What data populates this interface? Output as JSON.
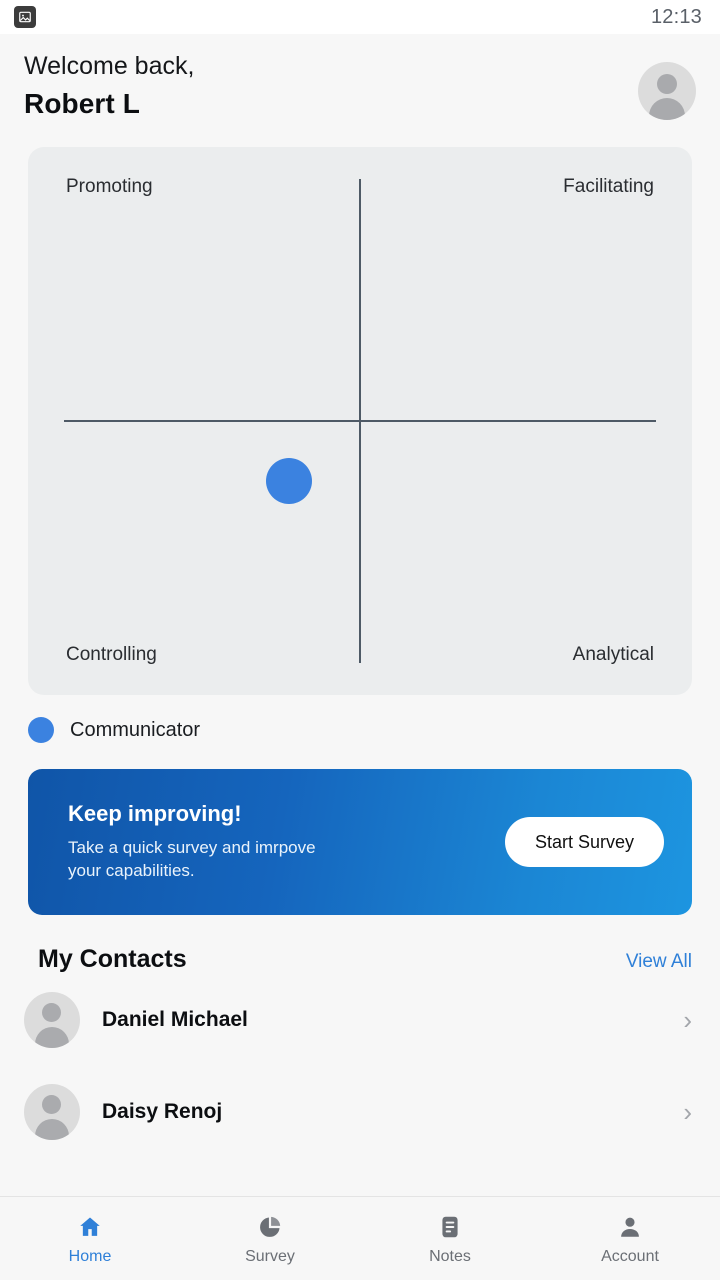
{
  "statusbar": {
    "time": "12:13",
    "left_icon": "image-icon"
  },
  "header": {
    "welcome": "Welcome back,",
    "username": "Robert L",
    "avatar": "user-avatar"
  },
  "chart_data": {
    "type": "scatter",
    "title": "",
    "quadrant_labels": {
      "top_left": "Promoting",
      "top_right": "Facilitating",
      "bottom_left": "Controlling",
      "bottom_right": "Analytical"
    },
    "x": [
      -0.18
    ],
    "y": [
      -0.22
    ],
    "xlim": [
      -1,
      1
    ],
    "ylim": [
      -1,
      1
    ],
    "grid": false,
    "series": [
      {
        "name": "Communicator",
        "values": [
          {
            "x": -0.18,
            "y": -0.22
          }
        ],
        "color": "#3b82e0"
      }
    ],
    "legend": [
      {
        "label": "Communicator",
        "color": "#3b82e0"
      }
    ],
    "legend_position": "below"
  },
  "legend": {
    "label": "Communicator",
    "color": "#3b82e0"
  },
  "promo": {
    "title": "Keep improving!",
    "subtitle_line1": "Take a quick survey and imrpove",
    "subtitle_line2": "your capabilities.",
    "button_label": "Start Survey"
  },
  "contacts": {
    "title": "My Contacts",
    "view_all": "View All",
    "items": [
      {
        "name": "Daniel Michael"
      },
      {
        "name": "Daisy Renoj"
      }
    ]
  },
  "bottomnav": {
    "items": [
      {
        "label": "Home",
        "icon": "home-icon",
        "active": true
      },
      {
        "label": "Survey",
        "icon": "pie-chart-icon",
        "active": false
      },
      {
        "label": "Notes",
        "icon": "notes-icon",
        "active": false
      },
      {
        "label": "Account",
        "icon": "person-icon",
        "active": false
      }
    ],
    "active_color": "#2f80d8",
    "inactive_color": "#6b6f75"
  }
}
